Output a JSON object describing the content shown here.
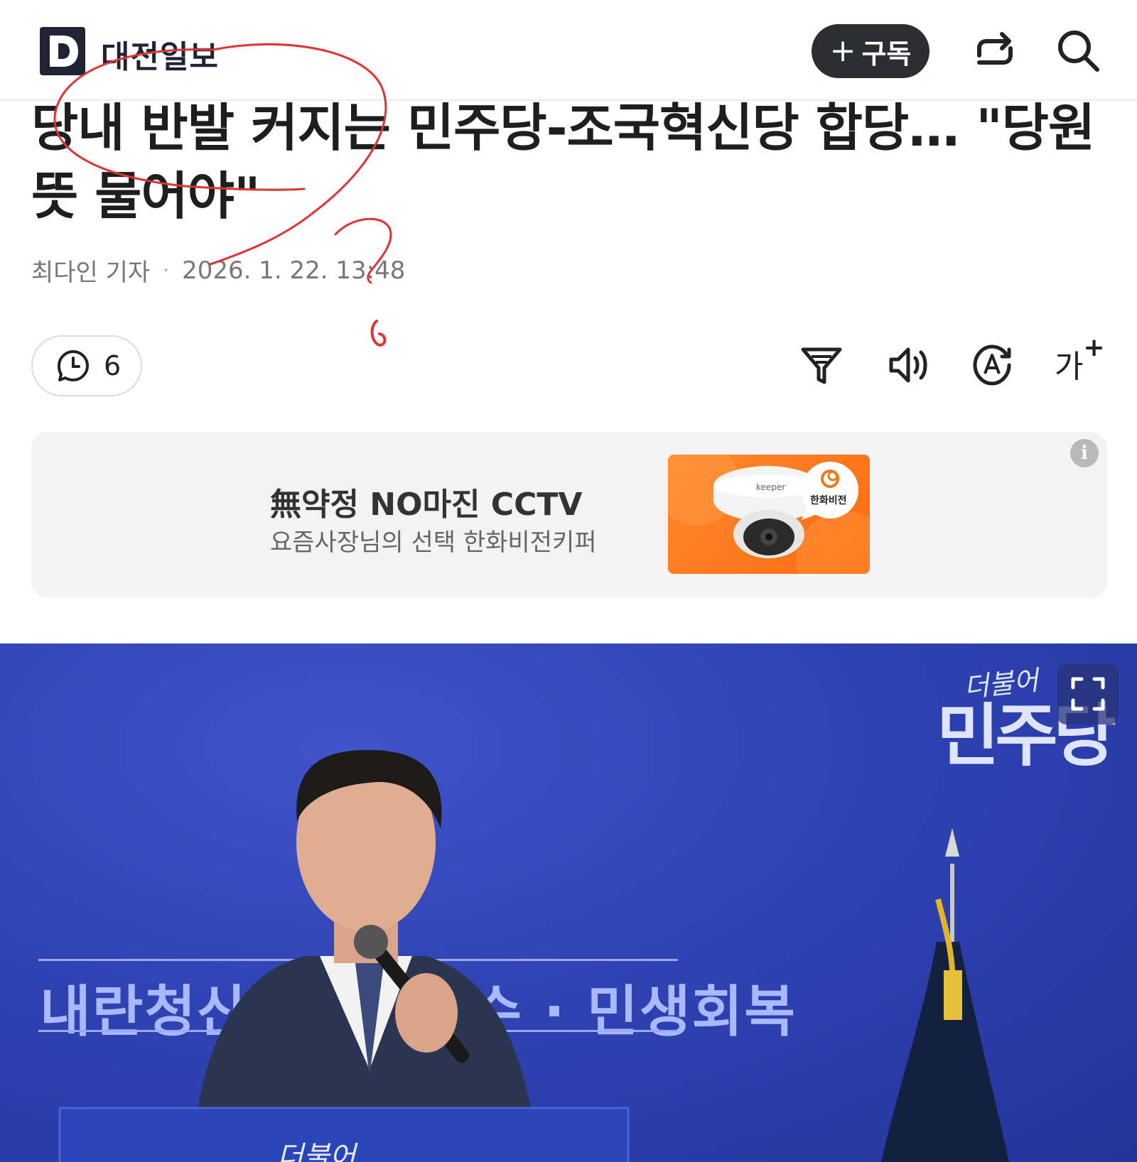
{
  "header": {
    "logo_letter": "D",
    "publisher_name": "대전일보",
    "subscribe_label": "구독",
    "share_icon": "share-arrows-icon",
    "search_icon": "search-icon"
  },
  "article": {
    "headline": "당내 반발 커지는 민주당-조국혁신당 합당… \"당원 뜻 물어야\"",
    "author": "최다인 기자",
    "timestamp": "2026. 1. 22. 13:48"
  },
  "toolbar": {
    "comment_count": "6",
    "font_size_label": "가",
    "font_size_plus": "+",
    "icons": [
      "comment-icon",
      "summary-filter-icon",
      "read-aloud-icon",
      "translate-icon",
      "font-size-icon"
    ]
  },
  "ad": {
    "title": "無약정 NO마진 CCTV",
    "subtitle": "요즘사장님의 선택 한화비전키퍼",
    "info_label": "i",
    "image_brand": "한화비전",
    "camera_brand": "keeper"
  },
  "photo": {
    "party_small": "더불어",
    "party_big": "민주당",
    "banner": "내란청산 · 개혁완수 · 민생회복",
    "podium_text": "더불어"
  },
  "colors": {
    "accent_dark": "#2b2d33",
    "logo_navy": "#1e2433",
    "ad_orange": "#ff7a1a",
    "photo_blue": "#2f43b4"
  }
}
